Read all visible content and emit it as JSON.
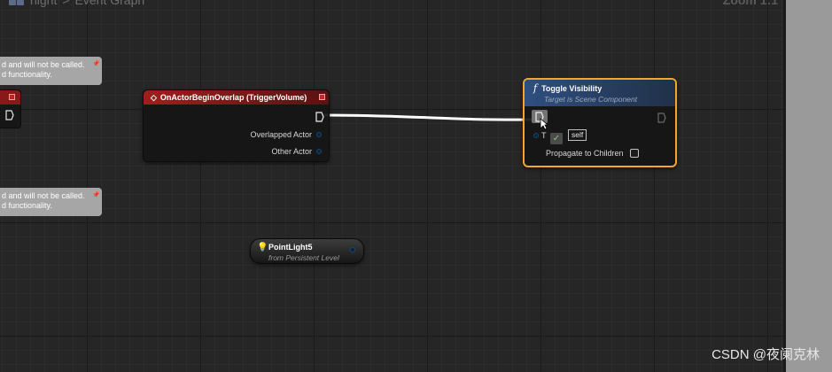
{
  "breadcrumb": {
    "blueprint": "night",
    "separator": ">",
    "graph": "Event Graph"
  },
  "zoom_label": "Zoom 1:1",
  "comments": [
    {
      "line1": "d and will not be called.",
      "line2": "d functionality."
    },
    {
      "line1": "d and will not be called.",
      "line2": "d functionality."
    }
  ],
  "event_node": {
    "title": "OnActorBeginOverlap (TriggerVolume)",
    "pins": [
      "Overlapped Actor",
      "Other Actor"
    ]
  },
  "toggle_node": {
    "title": "Toggle Visibility",
    "subtitle": "Target is Scene Component",
    "target_label": "T",
    "target_label_tail": "t",
    "target_default": "self",
    "propagate_label": "Propagate to Children",
    "propagate_checked": false
  },
  "pointlight_node": {
    "name": "PointLight5",
    "source": "from Persistent Level"
  },
  "watermark": "CSDN @夜阑克林",
  "colors": {
    "event_header": "#a21d1d",
    "function_header": "#2f4f80",
    "selection_outline": "#f3a62b",
    "object_pin": "#0f4a78",
    "comment": "#a6a6a6",
    "grid_background": "#262626"
  },
  "icons": {
    "event": "diamond-icon",
    "function": "function-f-icon",
    "pointlight": "lightbulb-icon",
    "cursor": "mouse-cursor-icon"
  }
}
